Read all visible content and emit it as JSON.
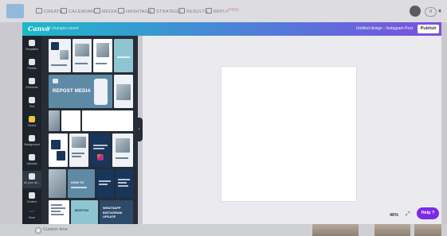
{
  "topnav": {
    "items": [
      {
        "label": "CREATE",
        "icon": "pencil-icon"
      },
      {
        "label": "CALENDAR",
        "icon": "calendar-icon"
      },
      {
        "label": "MEDIA",
        "icon": "folder-icon"
      },
      {
        "label": "HASHTAGS",
        "icon": "hashtag-icon"
      },
      {
        "label": "STRATEGY",
        "icon": "grid-icon"
      },
      {
        "label": "RESULTS",
        "icon": "chart-icon"
      },
      {
        "label": "REPLY",
        "icon": "at-icon"
      }
    ],
    "subscription": "Pro",
    "notifications_count": "0"
  },
  "canva": {
    "logo": "Canva",
    "saved_status": "All changes saved",
    "document_title": "Untitled design - Instagram Post",
    "publish_label": "Publish"
  },
  "sidebar": {
    "items": [
      {
        "label": "Templates",
        "icon": "templates-icon"
      },
      {
        "label": "Photos",
        "icon": "photos-icon"
      },
      {
        "label": "Elements",
        "icon": "elements-icon"
      },
      {
        "label": "Text",
        "icon": "text-icon"
      },
      {
        "label": "Charts",
        "icon": "charts-icon"
      },
      {
        "label": "Background",
        "icon": "background-icon"
      },
      {
        "label": "Uploads",
        "icon": "uploads-icon"
      },
      {
        "label": "All your de...",
        "icon": "all-designs-icon"
      },
      {
        "label": "Folders",
        "icon": "folders-icon"
      },
      {
        "label": "More",
        "icon": "more-icon"
      }
    ],
    "active_index": 7
  },
  "panel": {
    "featured_text": "REPOST MEDIA",
    "template_small_texts": [
      "HOW TO",
      "WHATSAPP",
      "INSTAGRAM UPDATE",
      "BOSTON"
    ]
  },
  "canvas": {
    "zoom": "46%",
    "help_label": "Help ?"
  },
  "bottom": {
    "checkbox_label": "Custom time"
  },
  "colors": {
    "accent_purple": "#7d2ae8",
    "gradient_start": "#1cb9c8",
    "gradient_end": "#7c4fe0",
    "sidebar_bg": "#1d232b",
    "panel_bg": "#262d36"
  }
}
